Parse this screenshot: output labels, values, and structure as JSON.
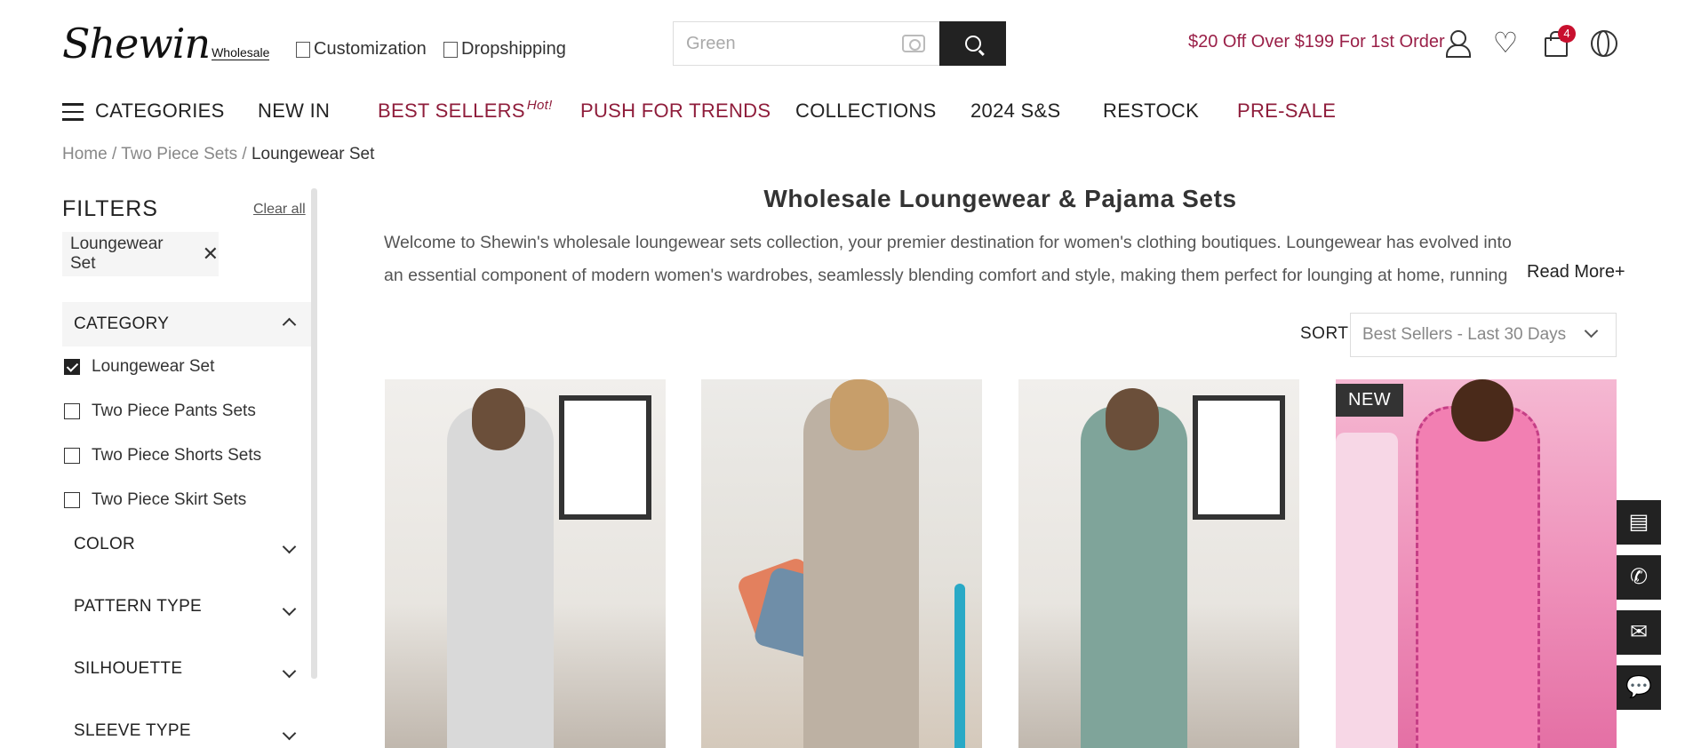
{
  "header": {
    "logo_main": "Shewin",
    "logo_sub": "Wholesale",
    "links": [
      {
        "label": "Customization"
      },
      {
        "label": "Dropshipping"
      }
    ],
    "search": {
      "placeholder": "Green"
    },
    "promo": "$20 Off Over $199 For 1st Order",
    "cart_count": "4"
  },
  "nav": {
    "categories": "CATEGORIES",
    "items": [
      {
        "label": "NEW IN"
      },
      {
        "label": "BEST SELLERS",
        "tag": "Hot!"
      },
      {
        "label": "PUSH FOR TRENDS"
      },
      {
        "label": "COLLECTIONS"
      },
      {
        "label": "2024 S&S"
      },
      {
        "label": "RESTOCK"
      },
      {
        "label": "PRE-SALE"
      }
    ]
  },
  "breadcrumb": {
    "home": "Home",
    "sep": " / ",
    "parent": "Two Piece Sets",
    "current": "Loungewear Set"
  },
  "sidebar": {
    "title": "FILTERS",
    "clear_all": "Clear all",
    "active_filter": "Loungewear Set",
    "category": {
      "label": "CATEGORY",
      "options": [
        {
          "label": "Loungewear Set",
          "checked": true
        },
        {
          "label": "Two Piece Pants Sets",
          "checked": false
        },
        {
          "label": "Two Piece Shorts Sets",
          "checked": false
        },
        {
          "label": "Two Piece Skirt Sets",
          "checked": false
        }
      ]
    },
    "facets": [
      {
        "label": "COLOR"
      },
      {
        "label": "PATTERN TYPE"
      },
      {
        "label": "SILHOUETTE"
      },
      {
        "label": "SLEEVE TYPE"
      }
    ]
  },
  "main": {
    "title": "Wholesale Loungewear & Pajama Sets",
    "intro": "Welcome to Shewin's wholesale loungewear sets collection, your premier destination for women's clothing boutiques. Loungewear has evolved into an essential component of modern women's wardrobes, seamlessly blending comfort and style, making them perfect for lounging at home, running errands, or even enjoying",
    "read_more": "Read More+",
    "sort_label": "SORT",
    "sort_value": "Best Sellers - Last 30 Days",
    "products": [
      {
        "badge": "",
        "color": "grey"
      },
      {
        "badge": "",
        "color": "beige"
      },
      {
        "badge": "",
        "color": "green"
      },
      {
        "badge": "NEW",
        "color": "pink"
      }
    ]
  },
  "floating": [
    {
      "icon": "app-icon",
      "glyph": "▤"
    },
    {
      "icon": "whatsapp-icon",
      "glyph": "✆"
    },
    {
      "icon": "mail-icon",
      "glyph": "✉"
    },
    {
      "icon": "chat-icon",
      "glyph": "💬"
    }
  ]
}
